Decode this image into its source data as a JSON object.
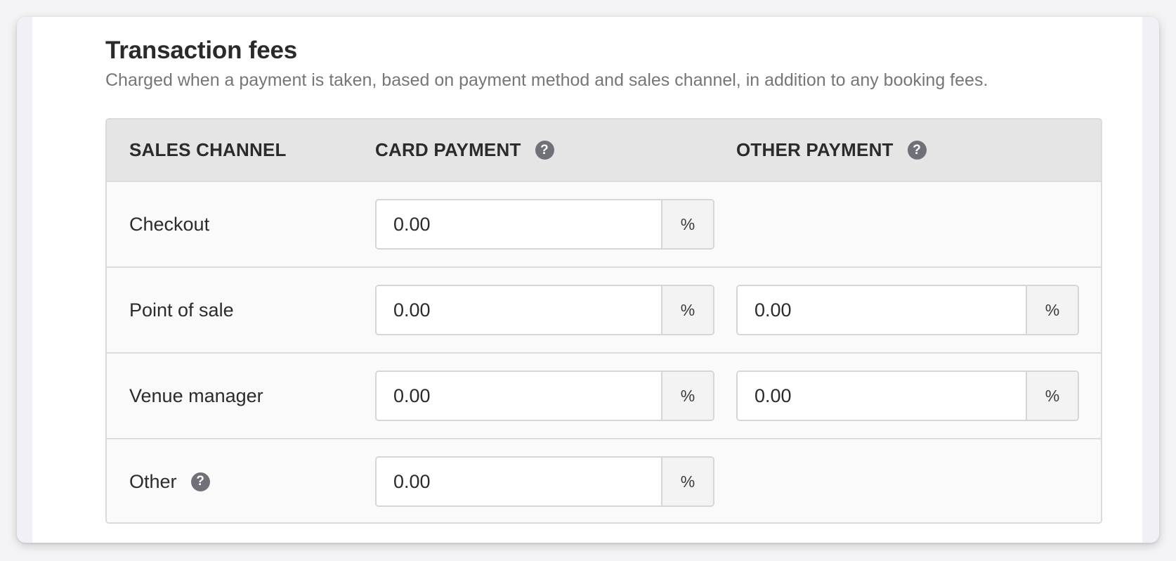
{
  "section": {
    "title": "Transaction fees",
    "subtitle": "Charged when a payment is taken, based on payment method and sales channel, in addition to any booking fees."
  },
  "table": {
    "headers": {
      "sales_channel": "SALES CHANNEL",
      "card_payment": "CARD PAYMENT",
      "other_payment": "OTHER PAYMENT"
    },
    "help_glyph": "?",
    "unit": "%",
    "rows": [
      {
        "label": "Checkout",
        "card_value": "0.00",
        "other_value": null,
        "has_help": false
      },
      {
        "label": "Point of sale",
        "card_value": "0.00",
        "other_value": "0.00",
        "has_help": false
      },
      {
        "label": "Venue manager",
        "card_value": "0.00",
        "other_value": "0.00",
        "has_help": false
      },
      {
        "label": "Other",
        "card_value": "0.00",
        "other_value": null,
        "has_help": true
      }
    ]
  },
  "icons": {
    "help": "question-circle-icon"
  },
  "colors": {
    "help_icon_bg": "#707078",
    "header_bg": "#e5e5e5",
    "subtitle_text": "#767679"
  }
}
